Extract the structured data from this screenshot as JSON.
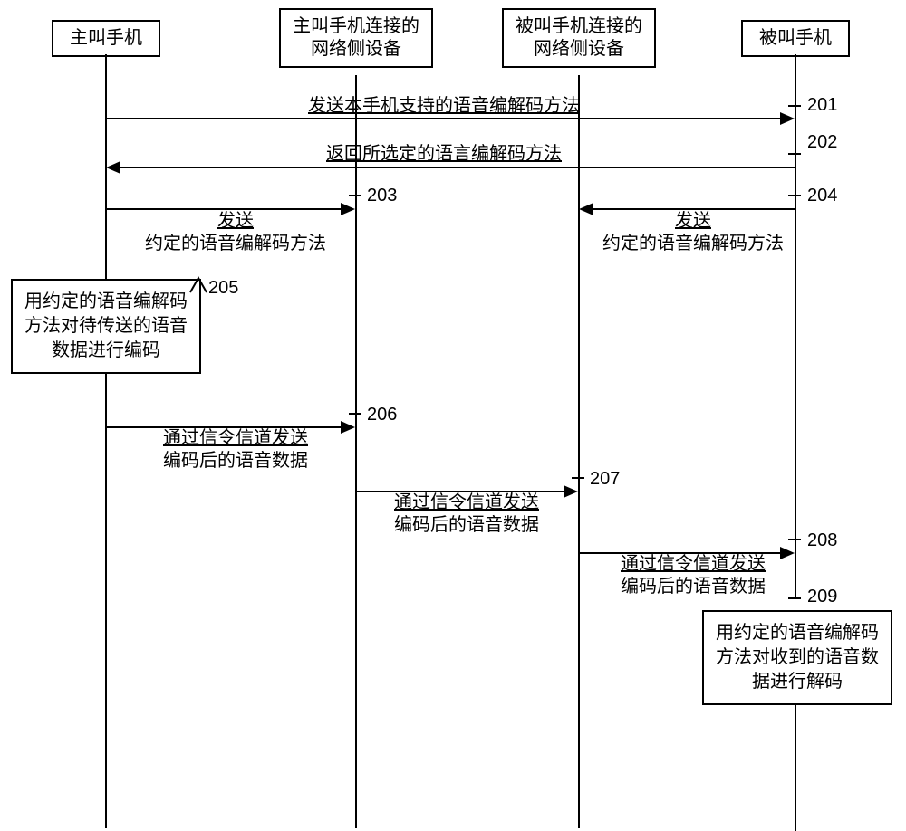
{
  "participants": {
    "caller": "主叫手机",
    "callerNet": "主叫手机连接的网络侧设备",
    "calledNet": "被叫手机连接的网络侧设备",
    "called": "被叫手机"
  },
  "steps": {
    "s201": {
      "num": "201",
      "text": "发送本手机支持的语音编解码方法"
    },
    "s202": {
      "num": "202",
      "text": "返回所选定的语言编解码方法"
    },
    "s203": {
      "num": "203",
      "line1": "发送",
      "line2": "约定的语音编解码方法"
    },
    "s204": {
      "num": "204",
      "line1": "发送",
      "line2": "约定的语音编解码方法"
    },
    "s205": {
      "num": "205",
      "text": "用约定的语音编解码方法对待传送的语音数据进行编码"
    },
    "s206": {
      "num": "206",
      "line1": "通过信令信道发送",
      "line2": "编码后的语音数据"
    },
    "s207": {
      "num": "207",
      "line1": "通过信令信道发送",
      "line2": "编码后的语音数据"
    },
    "s208": {
      "num": "208",
      "line1": "通过信令信道发送",
      "line2": "编码后的语音数据"
    },
    "s209": {
      "num": "209",
      "text": "用约定的语音编解码方法对收到的语音数据进行解码"
    }
  }
}
